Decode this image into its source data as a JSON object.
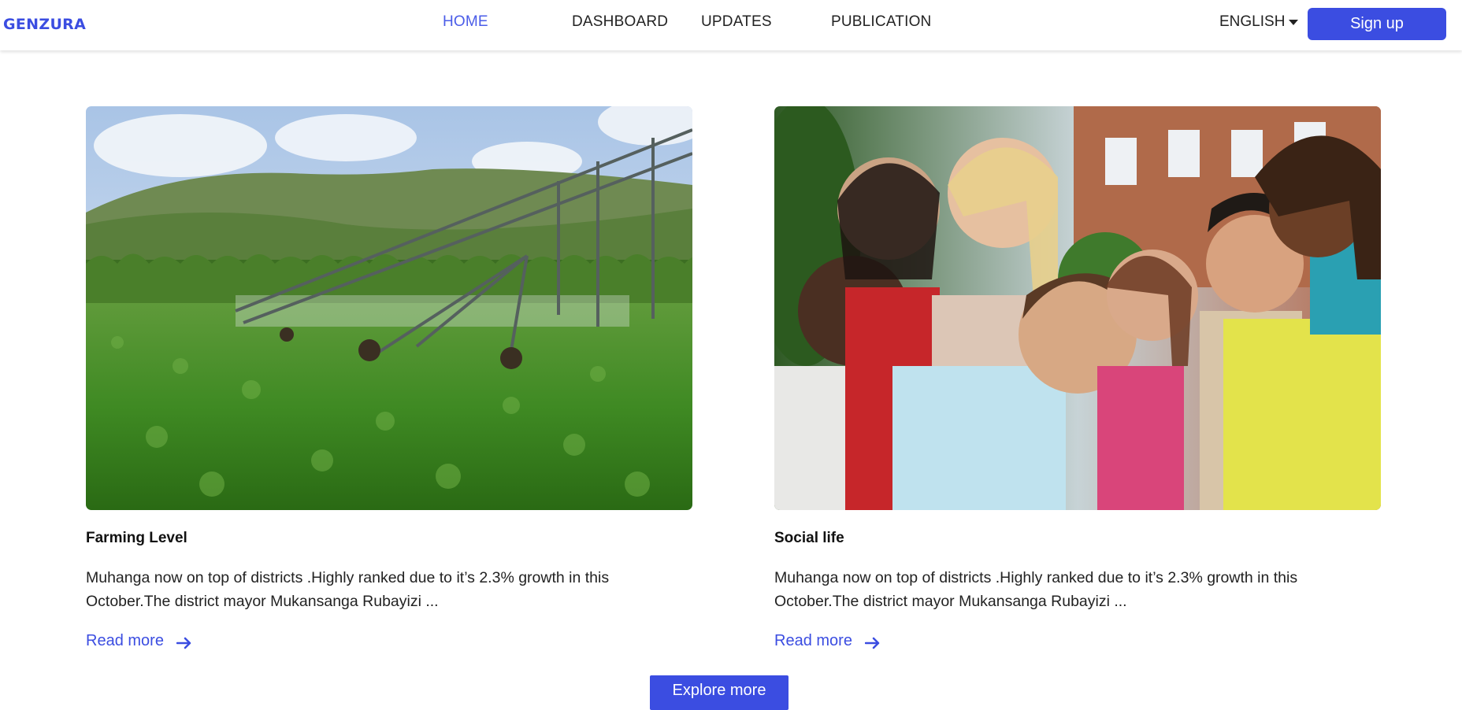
{
  "nav": {
    "logo": "GENZURA",
    "links": [
      "HOME",
      "DASHBOARD",
      "UPDATES",
      "PUBLICATION"
    ],
    "active": "HOME",
    "language": "ENGLISH",
    "signup_label": "Sign up"
  },
  "cards": [
    {
      "title": "Farming Level",
      "text": "Muhanga now on top of districts .Highly ranked due to it’s 2.3% growth in this October.The district mayor Mukansanga Rubayizi ...",
      "read_more": "Read more",
      "image": "farm-irrigation-photo"
    },
    {
      "title": "Social life",
      "text": "Muhanga now on top of districts .Highly ranked due to it’s 2.3% growth in this October.The district mayor Mukansanga Rubayizi ...",
      "read_more": "Read more",
      "image": "group-of-friends-photo"
    }
  ],
  "explore_label": "Explore more",
  "colors": {
    "accent": "#3b4de1",
    "active_link": "#4a5ce8",
    "text": "#222222"
  }
}
